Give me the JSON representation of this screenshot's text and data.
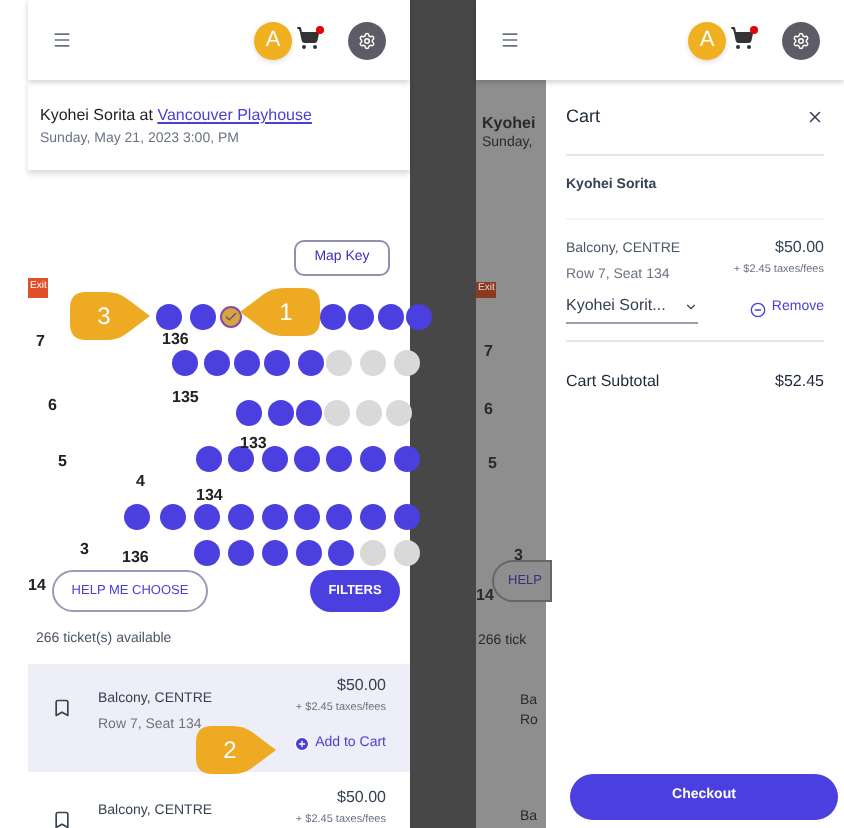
{
  "left_screen": {
    "header": {
      "avatar": "A",
      "cart_badge": true
    },
    "event": {
      "title": "Kyohei Sorita at ",
      "venue": "Vancouver Playhouse",
      "date": "Sunday, May 21, 2023 3:00, PM"
    },
    "seat_map": {
      "exit_label": "Exit",
      "map_key_button": "Map Key",
      "row_numbers": [
        "7",
        "6",
        "5",
        "4",
        "3",
        "14"
      ],
      "section_numbers": [
        "136",
        "135",
        "133",
        "134",
        "136"
      ],
      "seat_rows": [
        {
          "seats": [
            {
              "available": true,
              "selected": false
            },
            {
              "available": true,
              "selected": false
            },
            {
              "available": true,
              "selected": true
            },
            {
              "available": true,
              "selected": false
            },
            {
              "available": true,
              "selected": false
            },
            {
              "available": true,
              "selected": false
            },
            {
              "available": true,
              "selected": false
            }
          ]
        },
        {
          "seats": [
            {
              "available": true,
              "selected": false
            },
            {
              "available": true,
              "selected": false
            },
            {
              "available": true,
              "selected": false
            },
            {
              "available": true,
              "selected": false
            },
            {
              "available": true,
              "selected": false
            },
            {
              "available": false,
              "selected": false
            },
            {
              "available": false,
              "selected": false
            },
            {
              "available": false,
              "selected": false
            }
          ]
        },
        {
          "seats": [
            {
              "available": true,
              "selected": false
            },
            {
              "available": true,
              "selected": false
            },
            {
              "available": true,
              "selected": false
            },
            {
              "available": false,
              "selected": false
            },
            {
              "available": false,
              "selected": false
            },
            {
              "available": false,
              "selected": false
            }
          ]
        },
        {
          "seats": [
            {
              "available": true,
              "selected": false
            },
            {
              "available": true,
              "selected": false
            },
            {
              "available": true,
              "selected": false
            },
            {
              "available": true,
              "selected": false
            },
            {
              "available": true,
              "selected": false
            },
            {
              "available": true,
              "selected": false
            },
            {
              "available": true,
              "selected": false
            }
          ]
        },
        {
          "seats": [
            {
              "available": true,
              "selected": false
            },
            {
              "available": true,
              "selected": false
            },
            {
              "available": true,
              "selected": false
            },
            {
              "available": true,
              "selected": false
            },
            {
              "available": true,
              "selected": false
            },
            {
              "available": true,
              "selected": false
            },
            {
              "available": true,
              "selected": false
            },
            {
              "available": true,
              "selected": false
            },
            {
              "available": true,
              "selected": false
            }
          ]
        },
        {
          "seats": [
            {
              "available": true,
              "selected": false
            },
            {
              "available": true,
              "selected": false
            },
            {
              "available": true,
              "selected": false
            },
            {
              "available": true,
              "selected": false
            },
            {
              "available": true,
              "selected": false
            },
            {
              "available": false,
              "selected": false
            },
            {
              "available": false,
              "selected": false
            }
          ]
        }
      ],
      "callouts": [
        "3",
        "1"
      ]
    },
    "help_button": "HELP ME CHOOSE",
    "filters_button": "FILTERS",
    "tickets_available": "266 ticket(s) available",
    "tickets": [
      {
        "section": "Balcony, CENTRE",
        "seat": "Row 7, Seat 134",
        "price": "$50.00",
        "fees": "+ $2.45 taxes/fees",
        "action": "Add to Cart",
        "highlighted": true,
        "callout": "2"
      },
      {
        "section": "Balcony, CENTRE",
        "price": "$50.00",
        "fees": "+ $2.45 taxes/fees",
        "highlighted": false
      }
    ]
  },
  "right_screen": {
    "header": {
      "avatar": "A",
      "cart_badge": true
    },
    "background_texts": [
      "Kyohei",
      "Sunday,",
      "Exit",
      "7",
      "6",
      "5",
      "3",
      "14",
      "HELP",
      "266 tick",
      "Ba",
      "Ro",
      "Ba"
    ],
    "cart": {
      "title": "Cart",
      "buyer": "Kyohei Sorita",
      "items": [
        {
          "section": "Balcony, CENTRE",
          "seat": "Row 7, Seat 134",
          "price": "$50.00",
          "fees": "+ $2.45 taxes/fees",
          "holder": "Kyohei Sorit...",
          "remove": "Remove"
        }
      ],
      "subtotal_label": "Cart Subtotal",
      "subtotal": "$52.45",
      "checkout_button": "Checkout"
    }
  }
}
